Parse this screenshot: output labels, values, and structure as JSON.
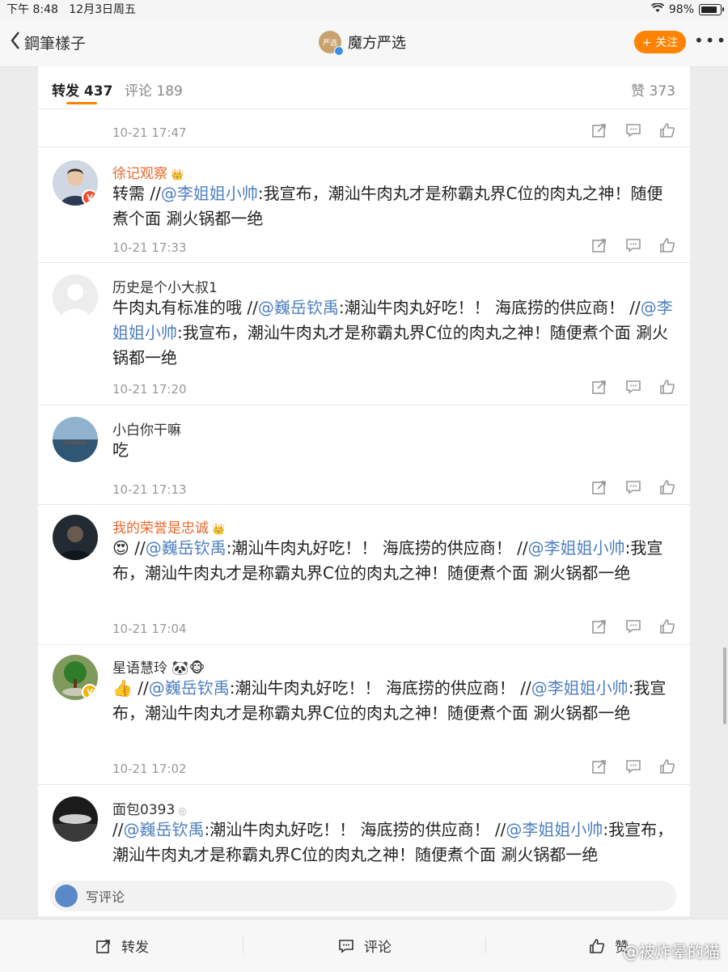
{
  "status": {
    "time": "下午 8:48",
    "date": "12月3日周五",
    "battery": "98%"
  },
  "nav": {
    "back_label": "鋼筆樣子",
    "title": "魔方严选",
    "brand_avatar_text": "严选",
    "follow_label": "+ 关注",
    "more_label": "•••"
  },
  "tabs": {
    "repost": "转发 437",
    "comment": "评论 189",
    "likes": "赞 373"
  },
  "top_partial": {
    "time": "10-21 17:47"
  },
  "reposts": [
    {
      "name": "徐记观察",
      "segments": [
        {
          "t": "转需 //"
        },
        {
          "t": "@李姐姐小帅",
          "m": true
        },
        {
          "t": ":我宣布，潮汕牛肉丸才是称霸丸界C位的肉丸之神！随便煮个面 涮火锅都一绝"
        }
      ],
      "time": "10-21 17:33"
    },
    {
      "name": "历史是个小大叔1",
      "segments": [
        {
          "t": "牛肉丸有标准的哦 //"
        },
        {
          "t": "@巍岳钦禹",
          "m": true
        },
        {
          "t": ":潮汕牛肉丸好吃！！ 海底捞的供应商！ //"
        },
        {
          "t": "@李姐姐小帅",
          "m": true
        },
        {
          "t": ":我宣布，潮汕牛肉丸才是称霸丸界C位的肉丸之神！随便煮个面 涮火锅都一绝"
        }
      ],
      "time": "10-21 17:20"
    },
    {
      "name": "小白你干嘛",
      "segments": [
        {
          "t": "吃"
        }
      ],
      "time": "10-21 17:13"
    },
    {
      "name": "我的荣誉是忠诚",
      "segments": [
        {
          "t": "😍 //"
        },
        {
          "t": "@巍岳钦禹",
          "m": true
        },
        {
          "t": ":潮汕牛肉丸好吃！！ 海底捞的供应商！ //"
        },
        {
          "t": "@李姐姐小帅",
          "m": true
        },
        {
          "t": ":我宣布，潮汕牛肉丸才是称霸丸界C位的肉丸之神！随便煮个面 涮火锅都一绝"
        }
      ],
      "time": "10-21 17:04"
    },
    {
      "name": "星语慧玲 🐼🐵",
      "segments": [
        {
          "t": "👍 //"
        },
        {
          "t": "@巍岳钦禹",
          "m": true
        },
        {
          "t": ":潮汕牛肉丸好吃！！ 海底捞的供应商！ //"
        },
        {
          "t": "@李姐姐小帅",
          "m": true
        },
        {
          "t": ":我宣布，潮汕牛肉丸才是称霸丸界C位的肉丸之神！随便煮个面 涮火锅都一绝"
        }
      ],
      "time": "10-21 17:02"
    },
    {
      "name": "面包0393",
      "segments": [
        {
          "t": "//"
        },
        {
          "t": "@巍岳钦禹",
          "m": true
        },
        {
          "t": ":潮汕牛肉丸好吃！！ 海底捞的供应商！ //"
        },
        {
          "t": "@李姐姐小帅",
          "m": true
        },
        {
          "t": ":我宣布，潮汕牛肉丸才是称霸丸界C位的肉丸之神！随便煮个面 涮火锅都一绝"
        }
      ],
      "time": ""
    }
  ],
  "composer": {
    "placeholder": "写评论"
  },
  "bottom": {
    "repost": "转发",
    "comment": "评论",
    "like": "赞"
  },
  "watermark": "@被炸晕的猫",
  "colors": {
    "accent": "#ff8200",
    "mention": "#4d7fbf",
    "vip_name": "#e8692c"
  }
}
